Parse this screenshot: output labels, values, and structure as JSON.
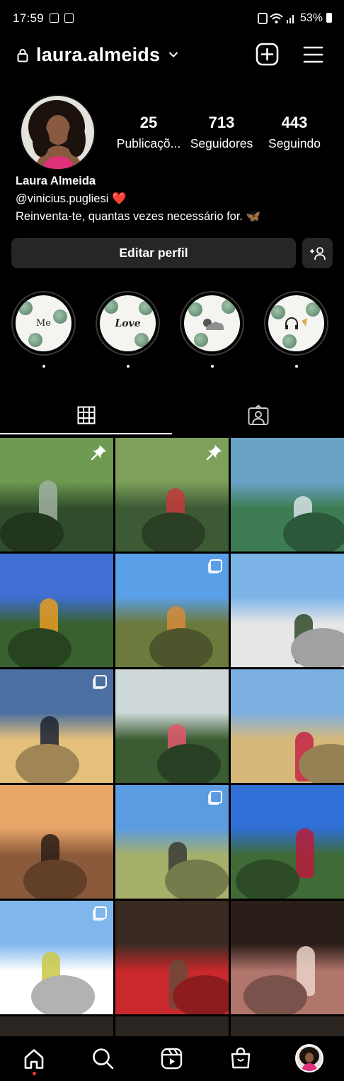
{
  "status_bar": {
    "time": "17:59",
    "battery": "53%"
  },
  "header": {
    "username": "laura.almeids",
    "icons": [
      "lock-icon",
      "chevron-down-icon",
      "new-post-icon",
      "menu-icon"
    ]
  },
  "profile": {
    "stats": [
      {
        "value": "25",
        "label": "Publicaçõ..."
      },
      {
        "value": "713",
        "label": "Seguidores"
      },
      {
        "value": "443",
        "label": "Seguindo"
      }
    ],
    "name": "Laura Almeida",
    "link": "@vinicius.pugliesi",
    "link_emoji": "❤️",
    "bio": "Reinventa-te, quantas vezes necessário for.",
    "bio_emoji": "🦋"
  },
  "buttons": {
    "edit_profile": "Editar perfil"
  },
  "highlights": [
    {
      "text": "Me",
      "dot": "."
    },
    {
      "text": "Love",
      "dot": "."
    },
    {
      "text": "",
      "dot": "."
    },
    {
      "text": "",
      "dot": "."
    }
  ],
  "grid": {
    "posts": [
      {
        "scene": "jungle path",
        "colors": [
          "#6e9a52",
          "#2f4d2a",
          "#9fb0a0"
        ],
        "badge": "pin"
      },
      {
        "scene": "heart swing",
        "colors": [
          "#7ea05b",
          "#3c5a34",
          "#c33a3a"
        ],
        "badge": "pin"
      },
      {
        "scene": "beach bay",
        "colors": [
          "#6aa3c8",
          "#3e7d54",
          "#d6dfe4"
        ],
        "badge": ""
      },
      {
        "scene": "forest colorful",
        "colors": [
          "#3f6fd2",
          "#38612f",
          "#e69b21"
        ],
        "badge": ""
      },
      {
        "scene": "elephant sculpture",
        "colors": [
          "#5aa0e8",
          "#6c7a3d",
          "#d58b3b"
        ],
        "badge": "multi"
      },
      {
        "scene": "christ statue",
        "colors": [
          "#7cb4e8",
          "#e6e6e6",
          "#2f4a2a"
        ],
        "badge": ""
      },
      {
        "scene": "sunrise clouds",
        "colors": [
          "#4a6fa0",
          "#e5c07a",
          "#1b2233"
        ],
        "badge": "multi"
      },
      {
        "scene": "greenhouse",
        "colors": [
          "#cfd8d8",
          "#3b5c33",
          "#e0586a"
        ],
        "badge": ""
      },
      {
        "scene": "building arches",
        "colors": [
          "#7cb0e0",
          "#d6b87a",
          "#c62546"
        ],
        "badge": ""
      },
      {
        "scene": "sunset",
        "colors": [
          "#e7a567",
          "#8a5a3a",
          "#2b1d16"
        ],
        "badge": ""
      },
      {
        "scene": "valley view",
        "colors": [
          "#5b9be0",
          "#a7b06a",
          "#3b3b33"
        ],
        "badge": "multi"
      },
      {
        "scene": "lake couple",
        "colors": [
          "#2f6fd6",
          "#3f6b37",
          "#b71d3c"
        ],
        "badge": ""
      },
      {
        "scene": "sun glare",
        "colors": [
          "#7fb7ec",
          "#ffffff",
          "#c9c844"
        ],
        "badge": "multi"
      },
      {
        "scene": "portrait red",
        "colors": [
          "#3a2b22",
          "#c9282c",
          "#6a4a3a"
        ],
        "badge": ""
      },
      {
        "scene": "portrait hair",
        "colors": [
          "#2a1e18",
          "#b0756b",
          "#e9d3c6"
        ],
        "badge": ""
      }
    ]
  },
  "nav": {
    "items": [
      "home-icon",
      "search-icon",
      "reels-icon",
      "shop-icon",
      "profile-avatar"
    ]
  }
}
